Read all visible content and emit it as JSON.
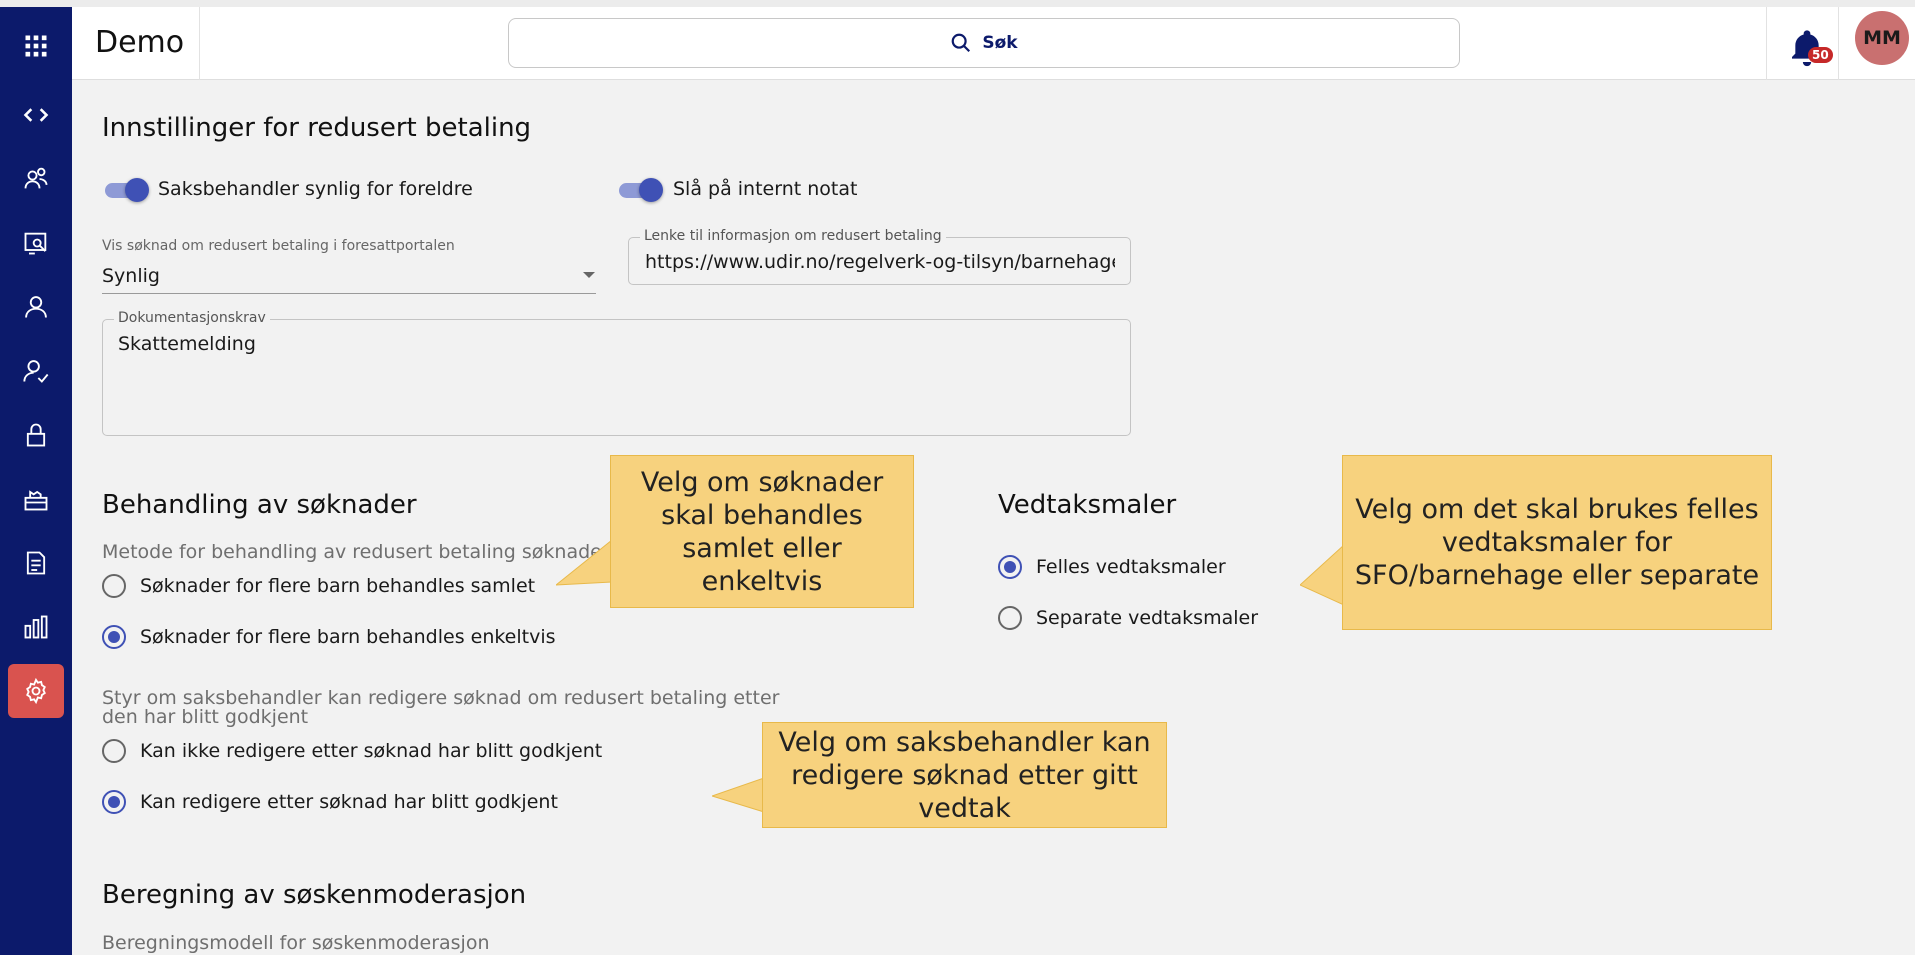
{
  "header": {
    "app_title": "Demo",
    "search_label": "Søk",
    "notification_count": "50",
    "avatar_initials": "MM"
  },
  "sidebar": {
    "items": [
      {
        "icon": "apps-grid-icon"
      },
      {
        "icon": "code-icon"
      },
      {
        "icon": "users-icon"
      },
      {
        "icon": "case-search-icon"
      },
      {
        "icon": "person-icon"
      },
      {
        "icon": "person-check-icon"
      },
      {
        "icon": "lock-icon"
      },
      {
        "icon": "kindergarten-icon"
      },
      {
        "icon": "document-icon"
      },
      {
        "icon": "bar-chart-icon"
      },
      {
        "icon": "gear-icon",
        "active": true
      }
    ],
    "active_color": "#d9534f",
    "bg_color": "#0c1a6b"
  },
  "settings": {
    "title": "Innstillinger for redusert betaling",
    "toggle_caseworker_visible": {
      "label": "Saksbehandler synlig for foreldre",
      "on": true
    },
    "toggle_internal_note": {
      "label": "Slå på internt notat",
      "on": true
    },
    "portal_visibility": {
      "label": "Vis søknad om redusert betaling i foresattportalen",
      "value": "Synlig"
    },
    "info_link": {
      "label": "Lenke til informasjon om redusert betaling",
      "value": "https://www.udir.no/regelverk-og-tilsyn/barnehage/foreldrebetaling"
    },
    "documentation": {
      "label": "Dokumentasjonskrav",
      "value": "Skattemelding"
    }
  },
  "processing": {
    "title": "Behandling av søknader",
    "method_label": "Metode for behandling av redusert betaling søknader",
    "method_options": [
      {
        "label": "Søknader for flere barn behandles samlet",
        "checked": false
      },
      {
        "label": "Søknader for flere barn behandles enkeltvis",
        "checked": true
      }
    ],
    "edit_label_line1": "Styr om saksbehandler kan redigere søknad om redusert betaling etter",
    "edit_label_line2": "den har blitt godkjent",
    "edit_options": [
      {
        "label": "Kan ikke redigere etter søknad har blitt godkjent",
        "checked": false
      },
      {
        "label": "Kan redigere etter søknad har blitt godkjent",
        "checked": true
      }
    ]
  },
  "templates": {
    "title": "Vedtaksmaler",
    "options": [
      {
        "label": "Felles vedtaksmaler",
        "checked": true
      },
      {
        "label": "Separate vedtaksmaler",
        "checked": false
      }
    ]
  },
  "sibling": {
    "title": "Beregning av søskenmoderasjon",
    "model_label": "Beregningsmodell for søskenmoderasjon"
  },
  "callouts": {
    "processing": "Velg om søknader skal behandles samlet eller enkeltvis",
    "templates": "Velg om det skal brukes felles vedtaksmaler for SFO/barnehage eller separate",
    "edit": "Velg om saksbehandler kan redigere søknad etter gitt vedtak",
    "bg_color": "#f7d27e"
  }
}
